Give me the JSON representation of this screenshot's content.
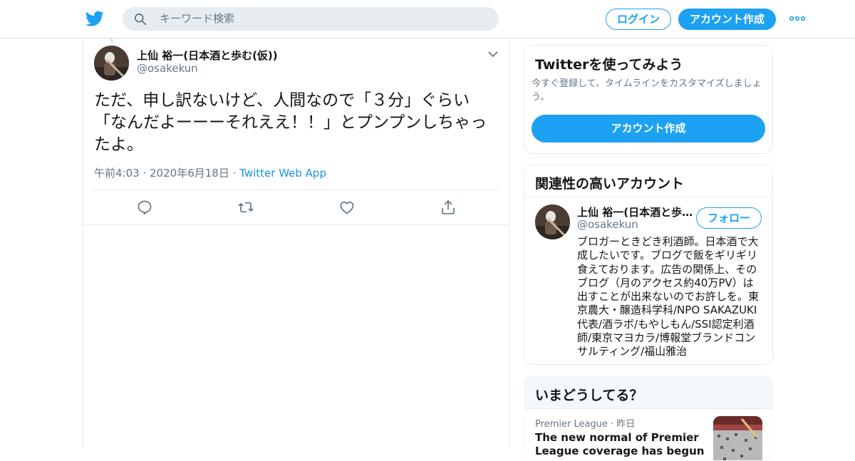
{
  "header": {
    "search_placeholder": "キーワード検索",
    "login_label": "ログイン",
    "signup_label": "アカウント作成",
    "brand_color": "#1da1f2"
  },
  "tweet": {
    "author_name": "上仙 裕一(日本酒と歩む(仮))",
    "author_handle": "@osakekun",
    "text": "ただ、申し訳ないけど、人間なので「３分」ぐらい「なんだよーーーそれええ！！」とプンプンしちゃったよ。",
    "time": "午前4:03",
    "date": "2020年6月18日",
    "source": "Twitter Web App",
    "actions": [
      "reply-icon",
      "retweet-icon",
      "like-icon",
      "share-icon"
    ]
  },
  "signup_card": {
    "title": "Twitterを使ってみよう",
    "description": "今すぐ登録して、タイムラインをカスタマイズしましょう。",
    "button_label": "アカウント作成"
  },
  "related": {
    "title": "関連性の高いアカウント",
    "name": "上仙 裕一(日本酒と歩む(仮))",
    "handle": "@osakekun",
    "follow_label": "フォロー",
    "bio": "ブロガーときどき利酒師。日本酒で大成したいです。ブログで飯をギリギリ食えております。広告の関係上、そのブログ（月のアクセス約40万PV）は出すことが出来ないのでお許しを。東京農大・醸造科学科/NPO SAKAZUKI代表/酒ラボ/もやしもん/SSI認定利酒師/東京マヨカラ/博報堂ブランドコンサルティング/福山雅治"
  },
  "trends": {
    "title": "いまどうしてる？",
    "category": "Premier League",
    "time": "昨日",
    "headline": "The new normal of Premier League coverage has begun"
  }
}
